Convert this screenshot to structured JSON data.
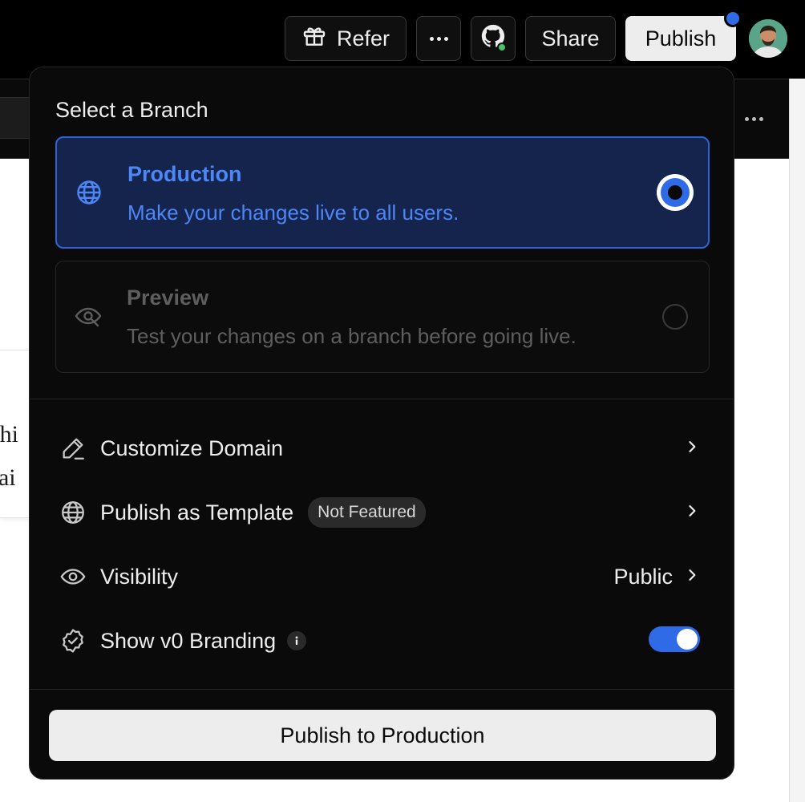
{
  "header": {
    "refer_label": "Refer",
    "share_label": "Share",
    "publish_label": "Publish",
    "icons": [
      "gift-icon",
      "more-horizontal-icon",
      "github-icon",
      "avatar"
    ],
    "accent_color": "#2f6be6"
  },
  "background": {
    "card_line_1": "shi",
    "card_line_2": "rai"
  },
  "popover": {
    "title": "Select a Branch",
    "branches": [
      {
        "title": "Production",
        "description": "Make your changes live to all users.",
        "selected": true,
        "icon": "globe-icon"
      },
      {
        "title": "Preview",
        "description": "Test your changes on a branch before going live.",
        "selected": false,
        "icon": "eye-scan-icon"
      }
    ],
    "options": {
      "customize_domain": {
        "label": "Customize Domain",
        "icon": "pencil-icon"
      },
      "publish_template": {
        "label": "Publish as Template",
        "badge": "Not Featured",
        "icon": "globe-icon"
      },
      "visibility": {
        "label": "Visibility",
        "value": "Public",
        "icon": "eye-icon"
      },
      "branding": {
        "label": "Show v0 Branding",
        "enabled": true,
        "icon": "badge-check-icon"
      }
    },
    "primary_action": "Publish to Production"
  }
}
